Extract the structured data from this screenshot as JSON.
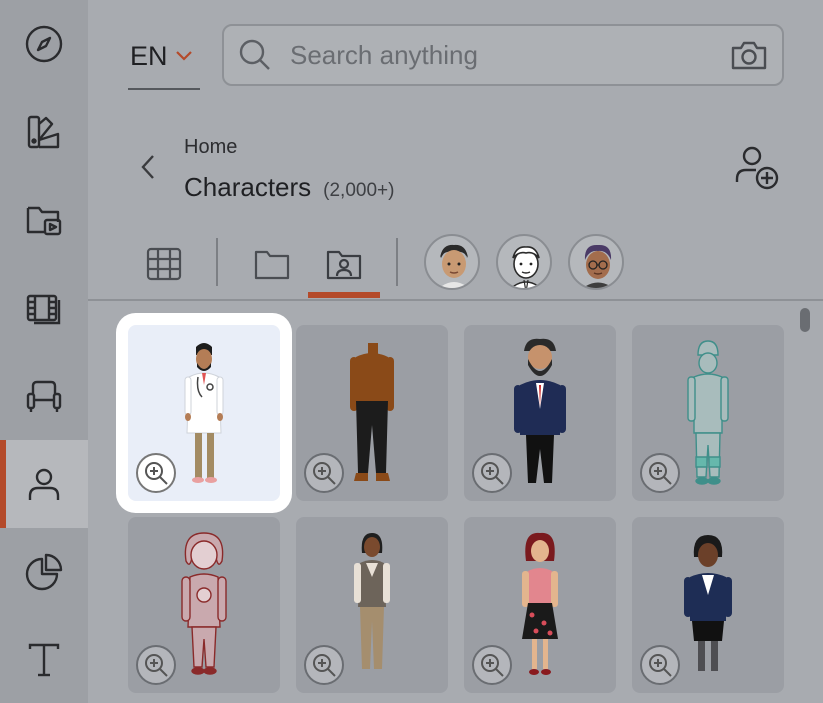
{
  "sidebar": {
    "items": [
      {
        "icon": "compass-icon"
      },
      {
        "icon": "palette-icon"
      },
      {
        "icon": "media-folder-icon"
      },
      {
        "icon": "film-icon"
      },
      {
        "icon": "armchair-icon"
      },
      {
        "icon": "person-icon",
        "active": true
      },
      {
        "icon": "pie-chart-icon"
      },
      {
        "icon": "text-icon"
      }
    ],
    "accent": "#b44a2a"
  },
  "header": {
    "language": "EN",
    "search_placeholder": "Search anything"
  },
  "breadcrumb": {
    "parent": "Home",
    "title": "Characters",
    "count": "(2,000+)"
  },
  "tabs": [
    {
      "icon": "grid-icon"
    },
    {
      "icon": "folder-icon"
    },
    {
      "icon": "person-folder-icon",
      "active": true
    },
    {
      "icon": "avatar-style-1"
    },
    {
      "icon": "avatar-style-2"
    },
    {
      "icon": "avatar-style-3"
    }
  ],
  "characters": [
    {
      "name": "doctor",
      "selected": true
    },
    {
      "name": "blank-body"
    },
    {
      "name": "bearded-businessman"
    },
    {
      "name": "outline-worker"
    },
    {
      "name": "outline-girl"
    },
    {
      "name": "woman-vest"
    },
    {
      "name": "woman-floral-skirt"
    },
    {
      "name": "woman-blazer"
    }
  ]
}
